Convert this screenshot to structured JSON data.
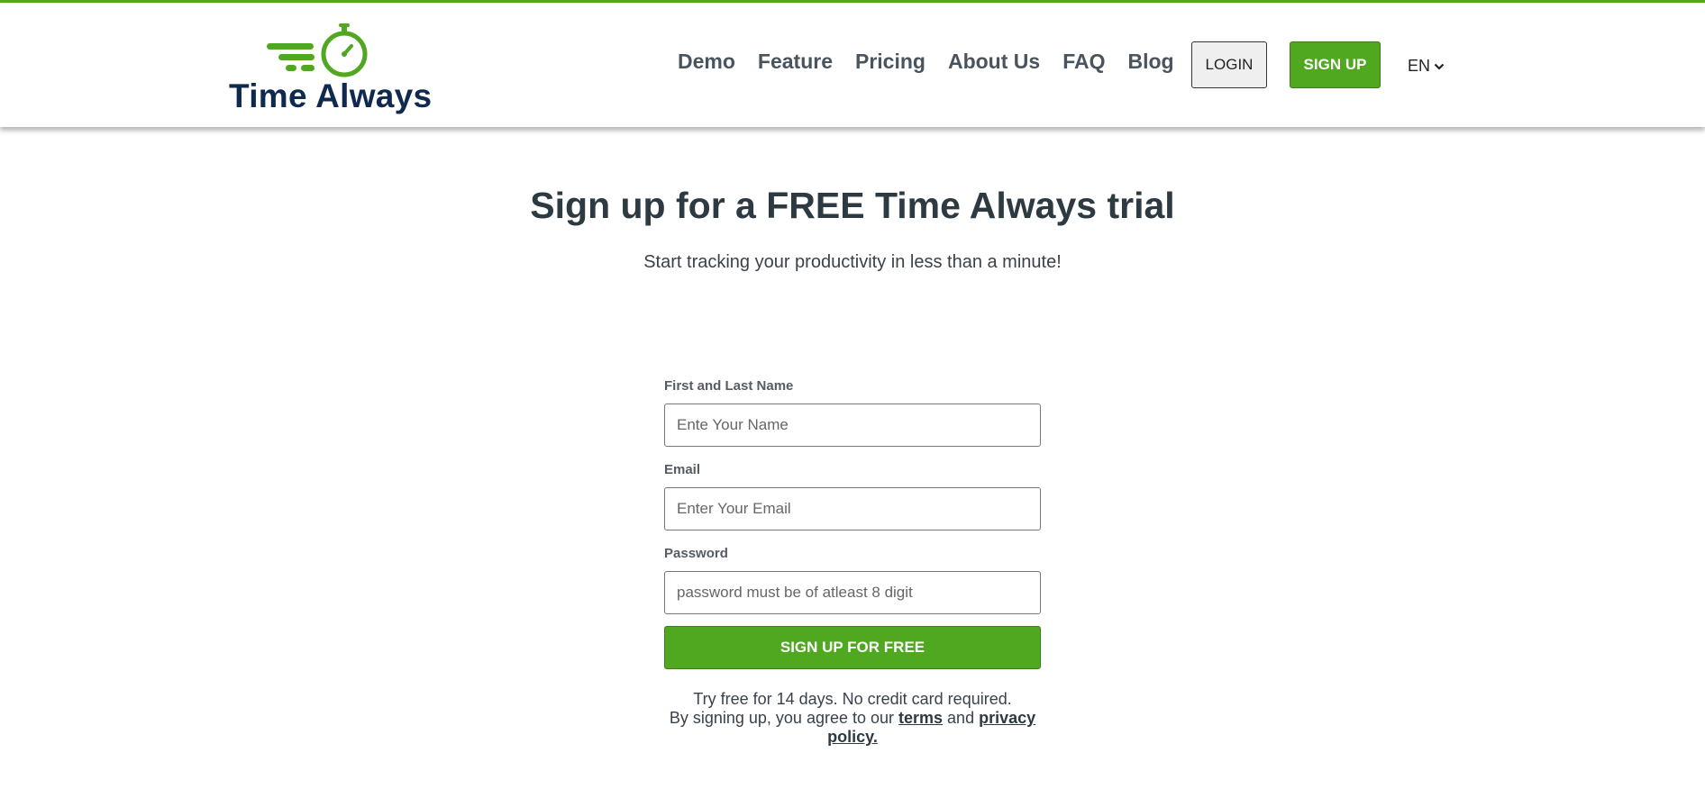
{
  "brand": {
    "name": "Time Always",
    "logo_icon": "stopwatch-speed-icon",
    "colors": {
      "accent": "#4fa81f",
      "navy": "#0f2a4e"
    }
  },
  "nav": {
    "items": [
      "Demo",
      "Feature",
      "Pricing",
      "About Us",
      "FAQ",
      "Blog"
    ],
    "login_label": "LOGIN",
    "signup_label": "SIGN UP",
    "language": "EN",
    "language_icon": "chevron-down-icon"
  },
  "hero": {
    "title": "Sign up for a FREE Time Always trial",
    "subtitle": "Start tracking your productivity in less than a minute!"
  },
  "form": {
    "name_label": "First and Last Name",
    "name_placeholder": "Ente Your Name",
    "name_value": "",
    "email_label": "Email",
    "email_placeholder": "Enter Your Email",
    "email_value": "",
    "password_label": "Password",
    "password_placeholder": "password must be of atleast 8 digit",
    "password_value": "",
    "submit_label": "SIGN UP FOR FREE"
  },
  "fine_print": {
    "line1": "Try free for 14 days. No credit card required.",
    "line2_prefix": "By signing up, you agree to our ",
    "terms_link": "terms",
    "and_text": " and ",
    "privacy_link": "privacy policy."
  }
}
